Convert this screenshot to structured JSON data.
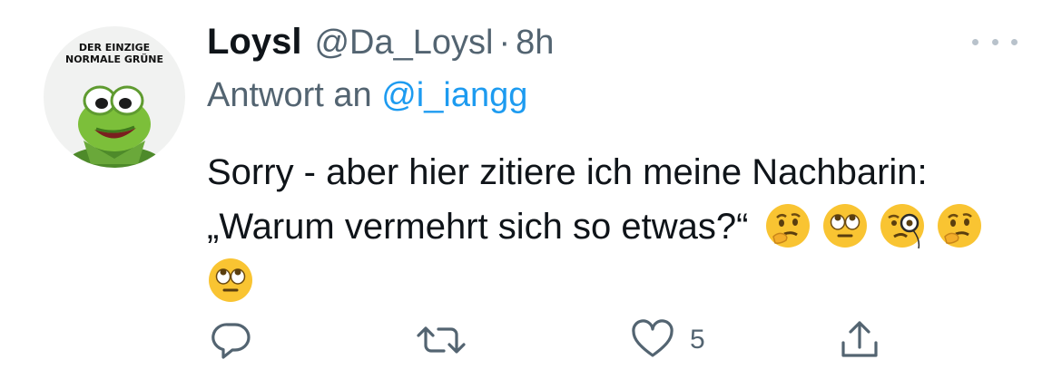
{
  "avatar": {
    "caption_line1": "DER EINZIGE",
    "caption_line2": "NORMALE GRÜNE"
  },
  "tweet": {
    "display_name": "Loysl",
    "handle": "@Da_Loysl",
    "separator": "·",
    "timestamp": "8h",
    "reply_prefix": "Antwort an",
    "reply_to": "@i_iangg",
    "text": "Sorry - aber hier zitiere ich meine Nachbarin: „Warum vermehrt sich so etwas?“",
    "emojis": [
      "thinking-face",
      "face-with-rolling-eyes",
      "face-with-monocle",
      "thinking-face",
      "face-with-rolling-eyes"
    ]
  },
  "actions": {
    "reply_icon": "speech-bubble-icon",
    "retweet_icon": "retweet-icon",
    "like_icon": "heart-icon",
    "like_count": "5",
    "share_icon": "share-icon"
  },
  "colors": {
    "text": "#0f1419",
    "secondary": "#536471",
    "link": "#1d9bf0",
    "icon": "#536471",
    "emoji_yellow": "#f9c432"
  }
}
